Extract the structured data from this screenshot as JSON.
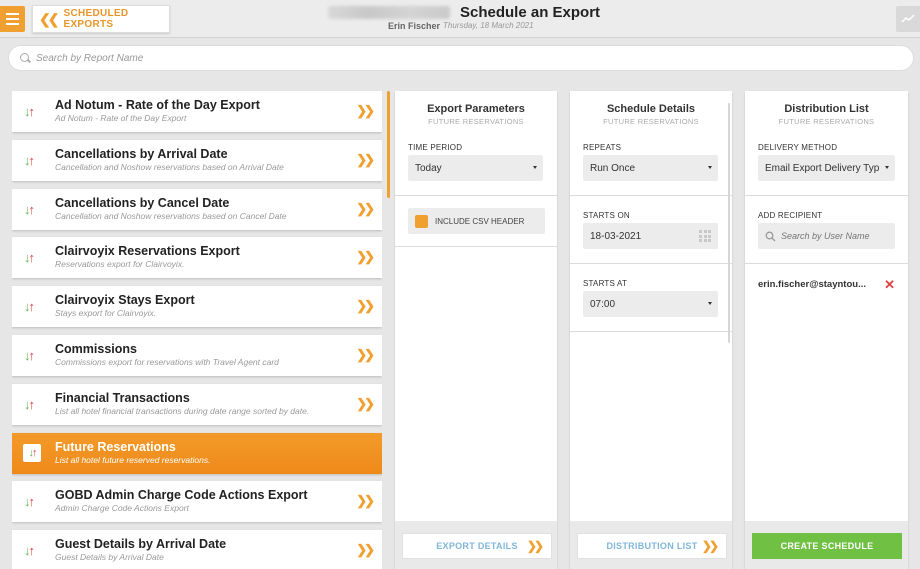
{
  "header": {
    "back_label": "SCHEDULED EXPORTS",
    "title": "Schedule an Export",
    "user": "Erin Fischer",
    "date": "Thursday, 18 March 2021"
  },
  "search": {
    "placeholder": "Search by Report Name"
  },
  "reports": [
    {
      "name": "Ad Notum - Rate of the Day Export",
      "desc": "Ad Notum - Rate of the Day Export"
    },
    {
      "name": "Cancellations by Arrival Date",
      "desc": "Cancellation and Noshow reservations based on Arrival Date"
    },
    {
      "name": "Cancellations by Cancel Date",
      "desc": "Cancellation and Noshow reservations based on Cancel Date"
    },
    {
      "name": "Clairvoyix Reservations Export",
      "desc": "Reservations export for Clairvoyix."
    },
    {
      "name": "Clairvoyix Stays Export",
      "desc": "Stays export for Clairvoyix."
    },
    {
      "name": "Commissions",
      "desc": "Commissions export for reservations with Travel Agent card"
    },
    {
      "name": "Financial Transactions",
      "desc": "List all hotel financial transactions during date range sorted by date."
    },
    {
      "name": "Future Reservations",
      "desc": "List all hotel future reserved reservations."
    },
    {
      "name": "GOBD Admin Charge Code Actions Export",
      "desc": "Admin Charge Code Actions Export"
    },
    {
      "name": "Guest Details by Arrival Date",
      "desc": "Guest Details by Arrival Date"
    }
  ],
  "export_params": {
    "title": "Export Parameters",
    "subtitle": "FUTURE RESERVATIONS",
    "time_period_label": "TIME PERIOD",
    "time_period_value": "Today",
    "csv_header_label": "INCLUDE CSV HEADER",
    "footer_button": "EXPORT DETAILS"
  },
  "schedule": {
    "title": "Schedule Details",
    "subtitle": "FUTURE RESERVATIONS",
    "repeats_label": "REPEATS",
    "repeats_value": "Run Once",
    "starts_on_label": "STARTS ON",
    "starts_on_value": "18-03-2021",
    "starts_at_label": "STARTS AT",
    "starts_at_value": "07:00",
    "footer_button": "DISTRIBUTION LIST"
  },
  "distribution": {
    "title": "Distribution List",
    "subtitle": "FUTURE RESERVATIONS",
    "delivery_label": "DELIVERY METHOD",
    "delivery_value": "Email Export Delivery Type",
    "add_recipient_label": "ADD RECIPIENT",
    "add_recipient_placeholder": "Search by User Name",
    "recipient_email": "erin.fischer@stayntou...",
    "footer_button": "CREATE SCHEDULE"
  },
  "colors": {
    "accent": "#f0a030",
    "success": "#6fc043",
    "link": "#7fb6d9",
    "danger": "#e04040"
  }
}
